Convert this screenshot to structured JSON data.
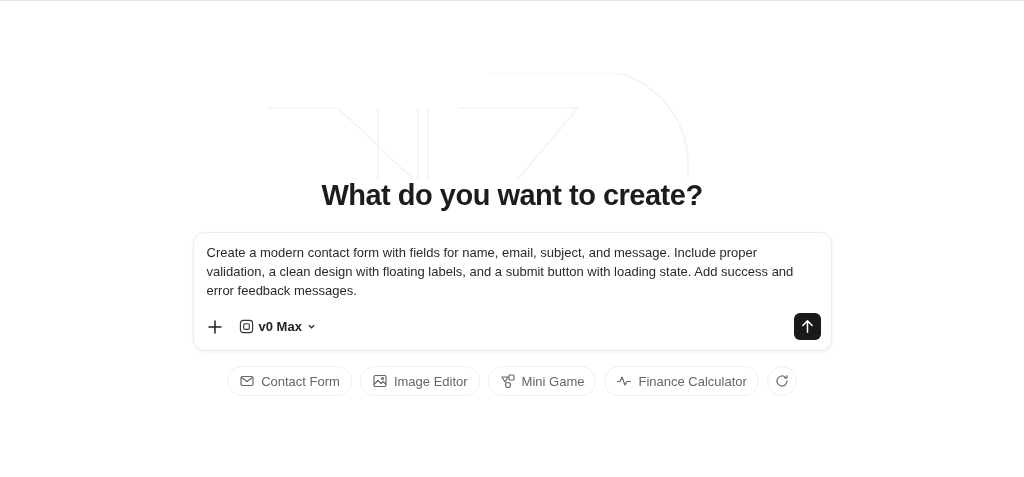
{
  "heading": "What do you want to create?",
  "prompt": {
    "value": "Create a modern contact form with fields for name, email, subject, and message. Include proper validation, a clean design with floating labels, and a submit button with loading state. Add success and error feedback messages."
  },
  "model_selector": {
    "label": "v0 Max"
  },
  "suggestions": [
    {
      "label": "Contact Form"
    },
    {
      "label": "Image Editor"
    },
    {
      "label": "Mini Game"
    },
    {
      "label": "Finance Calculator"
    }
  ]
}
